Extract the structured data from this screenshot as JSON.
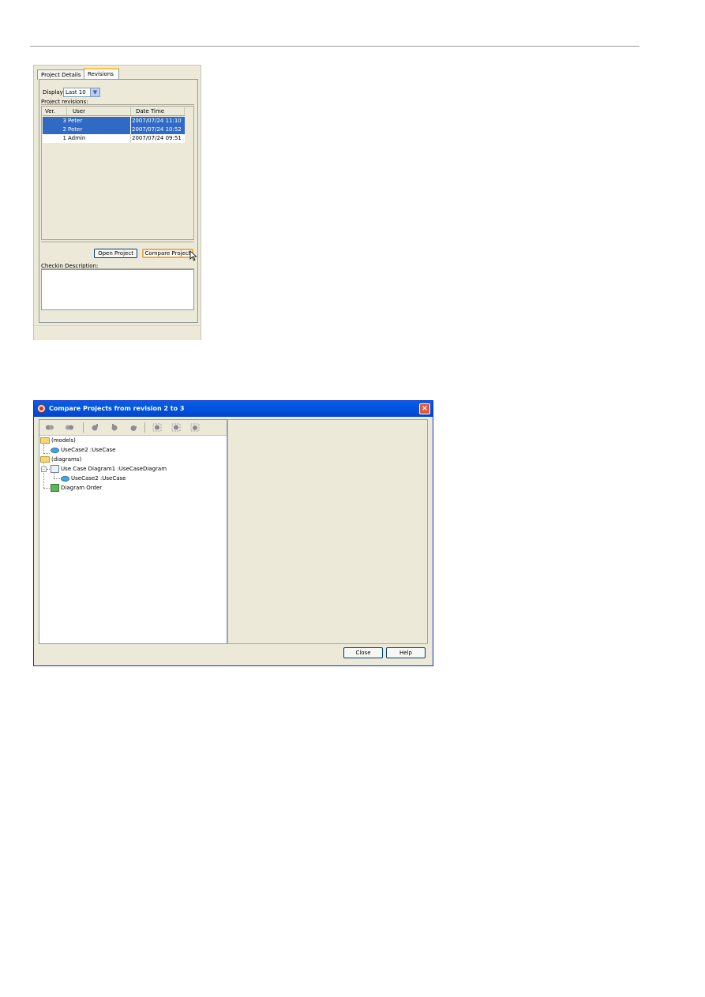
{
  "revisions_panel": {
    "tabs": [
      {
        "label": "Project Details"
      },
      {
        "label": "Revisions"
      }
    ],
    "display_label": "Display:",
    "display_value": "Last 10",
    "project_revisions_label": "Project revisions:",
    "columns": [
      "Ver.",
      "User",
      "Date Time"
    ],
    "rows": [
      {
        "ver": "3",
        "user": "Peter",
        "datetime": "2007/07/24 11:10",
        "selected": true
      },
      {
        "ver": "2",
        "user": "Peter",
        "datetime": "2007/07/24 10:52",
        "selected": true
      },
      {
        "ver": "1",
        "user": "Admin",
        "datetime": "2007/07/24 09:51",
        "selected": false
      }
    ],
    "open_project_label": "Open Project",
    "compare_project_label": "Compare Project",
    "checkin_description_label": "Checkin Description:"
  },
  "compare_dialog": {
    "title": "Compare Projects from revision 2 to 3",
    "tree": {
      "models_folder": "(models)",
      "models_usecase": "UseCase2 :UseCase",
      "diagrams_folder": "(diagrams)",
      "diagram_node": "Use Case Diagram1 :UseCaseDiagram",
      "diagram_child": "UseCase2 :UseCase",
      "diagram_order": "Diagram Order"
    },
    "close_label": "Close",
    "help_label": "Help"
  },
  "colors": {
    "selection": "#316ac5",
    "titlebar": "#0054e3",
    "window_bg": "#ece9d8"
  }
}
